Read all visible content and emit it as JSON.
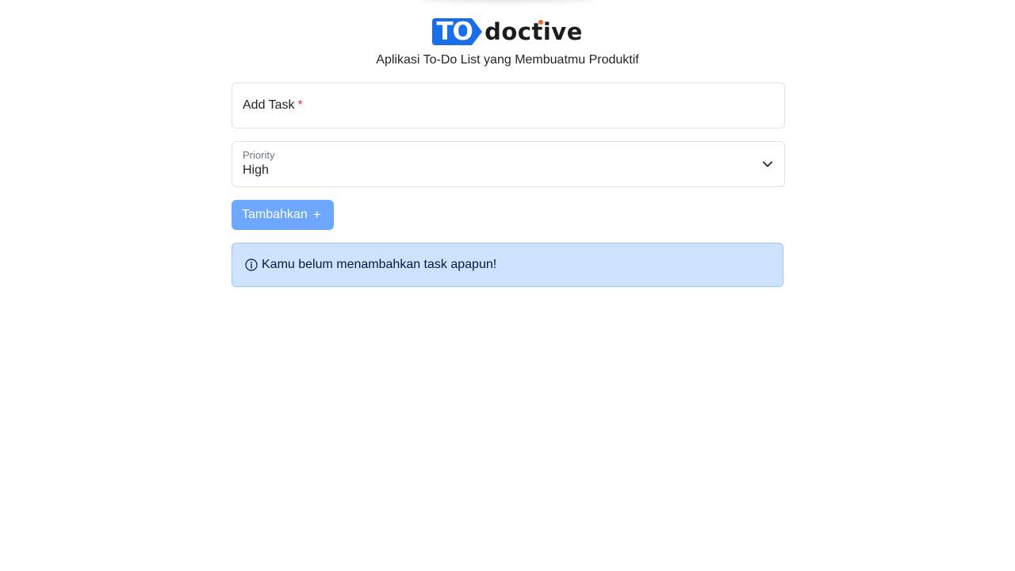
{
  "brand": {
    "logo_tag": "TO",
    "logo_word": "doctive",
    "subtitle": "Aplikasi To-Do List yang Membuatmu Produktif",
    "colors": {
      "tag_blue": "#1a6fe8",
      "dot_orange": "#f26b1d"
    }
  },
  "form": {
    "task_label": "Add Task",
    "task_required_mark": "*",
    "task_value": "",
    "priority_label": "Priority",
    "priority_value": "High",
    "priority_icon": "chevron-down-icon",
    "submit_label": "Tambahkan",
    "submit_icon": "+"
  },
  "alert": {
    "icon": "info-icon",
    "message": "Kamu belum menambahkan task apapun!"
  },
  "colors": {
    "primary_button": "#6ea8fe",
    "alert_background": "#cfe2ff",
    "alert_border": "#9ec5fe",
    "required": "#dc3545"
  }
}
